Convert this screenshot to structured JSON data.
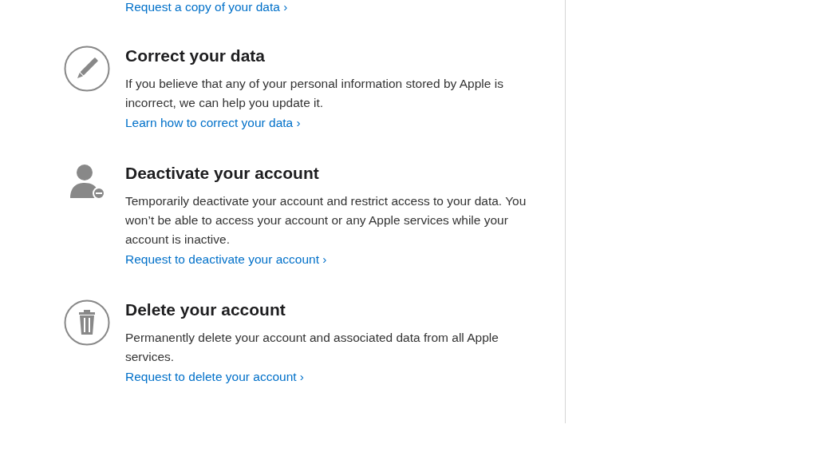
{
  "top_link": "Request a copy of your data ›",
  "sections": [
    {
      "kind": "pencil",
      "title": "Correct your data",
      "body": "If you believe that any of your personal information stored by Apple is incorrect, we can help you update it.",
      "link": "Learn how to correct your data ›"
    },
    {
      "kind": "person",
      "title": "Deactivate your account",
      "body": "Temporarily deactivate your account and restrict access to your data. You won’t be able to access your account or any Apple services while your account is inactive.",
      "link": "Request to deactivate your account ›"
    },
    {
      "kind": "trash",
      "title": "Delete your account",
      "body": "Permanently delete your account and associated data from all Apple services.",
      "link": "Request to delete your account ›"
    }
  ]
}
